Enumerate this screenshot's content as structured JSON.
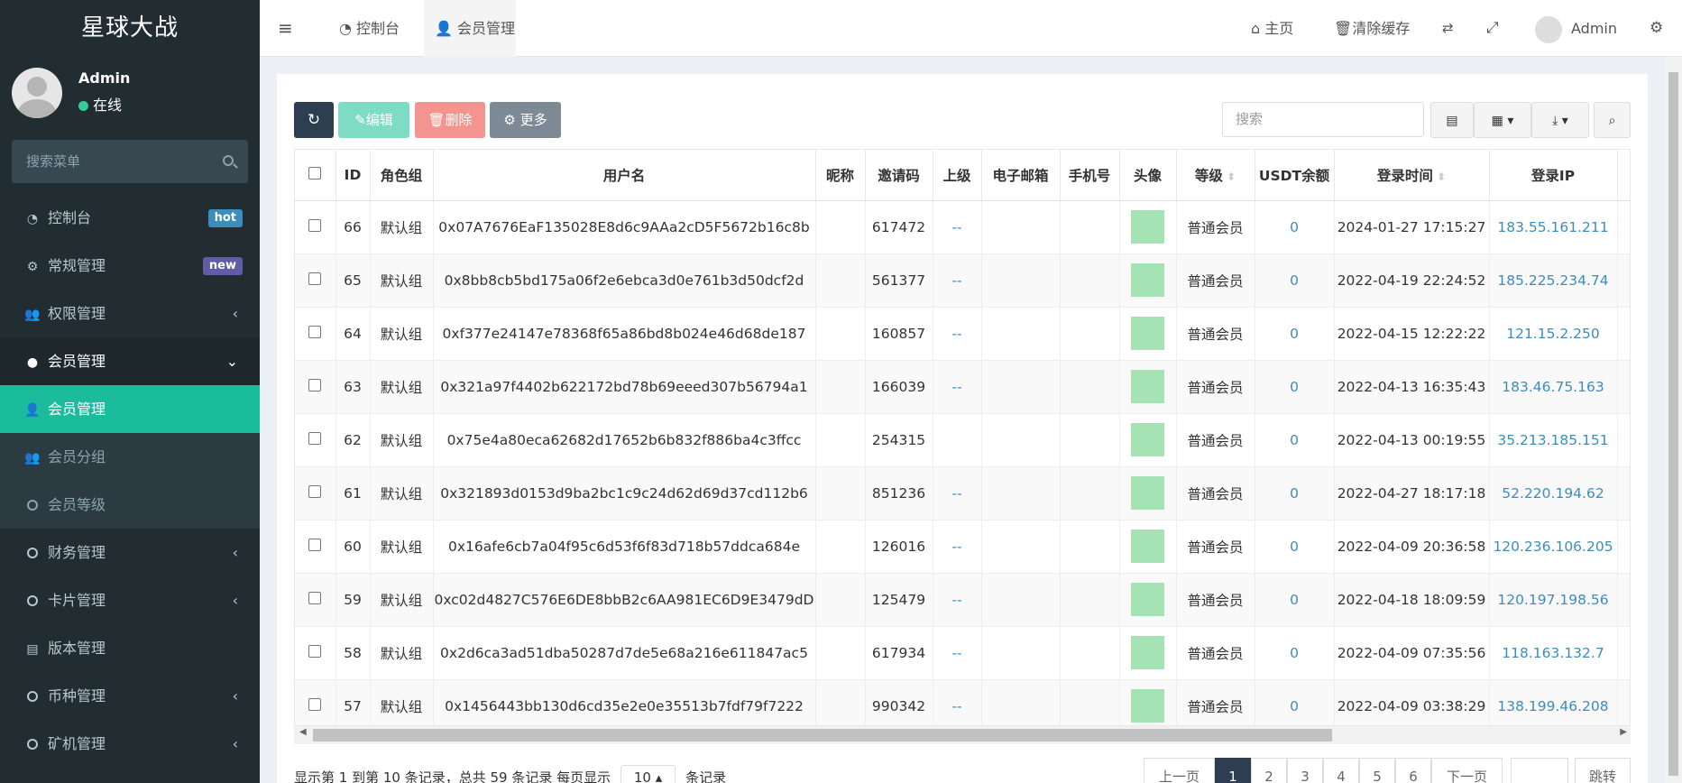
{
  "app": {
    "title": "星球大战"
  },
  "user": {
    "name": "Admin",
    "status": "在线"
  },
  "sidebar": {
    "search_placeholder": "搜索菜单",
    "items": [
      {
        "label": "控制台",
        "badge": "hot",
        "badge_color": "#3c8dbc"
      },
      {
        "label": "常规管理",
        "badge": "new",
        "badge_color": "#605ca8"
      },
      {
        "label": "权限管理"
      },
      {
        "label": "会员管理"
      },
      {
        "label": "会员管理"
      },
      {
        "label": "会员分组"
      },
      {
        "label": "会员等级"
      },
      {
        "label": "财务管理"
      },
      {
        "label": "卡片管理"
      },
      {
        "label": "版本管理"
      },
      {
        "label": "币种管理"
      },
      {
        "label": "矿机管理"
      }
    ]
  },
  "topbar": {
    "tabs": [
      {
        "label": "控制台"
      },
      {
        "label": "会员管理"
      }
    ],
    "home": "主页",
    "clear_cache": "清除缓存",
    "admin": "Admin"
  },
  "toolbar": {
    "edit": "编辑",
    "delete": "删除",
    "more": "更多",
    "search_placeholder": "搜索",
    "edit_color": "#7fdcc4",
    "delete_color": "#f49490",
    "more_color": "#7d8a96",
    "refresh_color": "#2c3e50"
  },
  "table": {
    "headers": [
      "ID",
      "角色组",
      "用户名",
      "昵称",
      "邀请码",
      "上级",
      "电子邮箱",
      "手机号",
      "头像",
      "等级",
      "USDT余额",
      "登录时间",
      "登录IP"
    ],
    "rows": [
      {
        "id": "66",
        "group": "默认组",
        "username": "0x07A7676EaF135028E8d6c9AAa2cD5F5672b16c8b",
        "nickname": "",
        "code": "617472",
        "parent": "--",
        "email": "",
        "phone": "",
        "level": "普通会员",
        "usdt": "0",
        "time": "2024-01-27 17:15:27",
        "ip": "183.55.161.211"
      },
      {
        "id": "65",
        "group": "默认组",
        "username": "0x8bb8cb5bd175a06f2e6ebca3d0e761b3d50dcf2d",
        "nickname": "",
        "code": "561377",
        "parent": "--",
        "email": "",
        "phone": "",
        "level": "普通会员",
        "usdt": "0",
        "time": "2022-04-19 22:24:52",
        "ip": "185.225.234.74"
      },
      {
        "id": "64",
        "group": "默认组",
        "username": "0xf377e24147e78368f65a86bd8b024e46d68de187",
        "nickname": "",
        "code": "160857",
        "parent": "--",
        "email": "",
        "phone": "",
        "level": "普通会员",
        "usdt": "0",
        "time": "2022-04-15 12:22:22",
        "ip": "121.15.2.250"
      },
      {
        "id": "63",
        "group": "默认组",
        "username": "0x321a97f4402b622172bd78b69eeed307b56794a1",
        "nickname": "",
        "code": "166039",
        "parent": "--",
        "email": "",
        "phone": "",
        "level": "普通会员",
        "usdt": "0",
        "time": "2022-04-13 16:35:43",
        "ip": "183.46.75.163"
      },
      {
        "id": "62",
        "group": "默认组",
        "username": "0x75e4a80eca62682d17652b6b832f886ba4c3ffcc",
        "nickname": "",
        "code": "254315",
        "parent": "",
        "email": "",
        "phone": "",
        "level": "普通会员",
        "usdt": "0",
        "time": "2022-04-13 00:19:55",
        "ip": "35.213.185.151"
      },
      {
        "id": "61",
        "group": "默认组",
        "username": "0x321893d0153d9ba2bc1c9c24d62d69d37cd112b6",
        "nickname": "",
        "code": "851236",
        "parent": "--",
        "email": "",
        "phone": "",
        "level": "普通会员",
        "usdt": "0",
        "time": "2022-04-27 18:17:18",
        "ip": "52.220.194.62"
      },
      {
        "id": "60",
        "group": "默认组",
        "username": "0x16afe6cb7a04f95c6d53f6f83d718b57ddca684e",
        "nickname": "",
        "code": "126016",
        "parent": "--",
        "email": "",
        "phone": "",
        "level": "普通会员",
        "usdt": "0",
        "time": "2022-04-09 20:36:58",
        "ip": "120.236.106.205"
      },
      {
        "id": "59",
        "group": "默认组",
        "username": "0xc02d4827C576E6DE8bbB2c6AA981EC6D9E3479dD",
        "nickname": "",
        "code": "125479",
        "parent": "--",
        "email": "",
        "phone": "",
        "level": "普通会员",
        "usdt": "0",
        "time": "2022-04-18 18:09:59",
        "ip": "120.197.198.56"
      },
      {
        "id": "58",
        "group": "默认组",
        "username": "0x2d6ca3ad51dba50287d7de5e68a216e611847ac5",
        "nickname": "",
        "code": "617934",
        "parent": "--",
        "email": "",
        "phone": "",
        "level": "普通会员",
        "usdt": "0",
        "time": "2022-04-09 07:35:56",
        "ip": "118.163.132.7"
      },
      {
        "id": "57",
        "group": "默认组",
        "username": "0x1456443bb130d6cd35e2e0e35513b7fdf79f7222",
        "nickname": "",
        "code": "990342",
        "parent": "--",
        "email": "",
        "phone": "",
        "level": "普通会员",
        "usdt": "0",
        "time": "2022-04-09 03:38:29",
        "ip": "138.199.46.208"
      }
    ]
  },
  "footer": {
    "summary": "显示第 1 到第 10 条记录，总共 59 条记录 每页显示",
    "page_size": "10",
    "records_suffix": "条记录",
    "prev": "上一页",
    "next": "下一页",
    "pages": [
      "1",
      "2",
      "3",
      "4",
      "5",
      "6"
    ],
    "jump": "跳转"
  }
}
